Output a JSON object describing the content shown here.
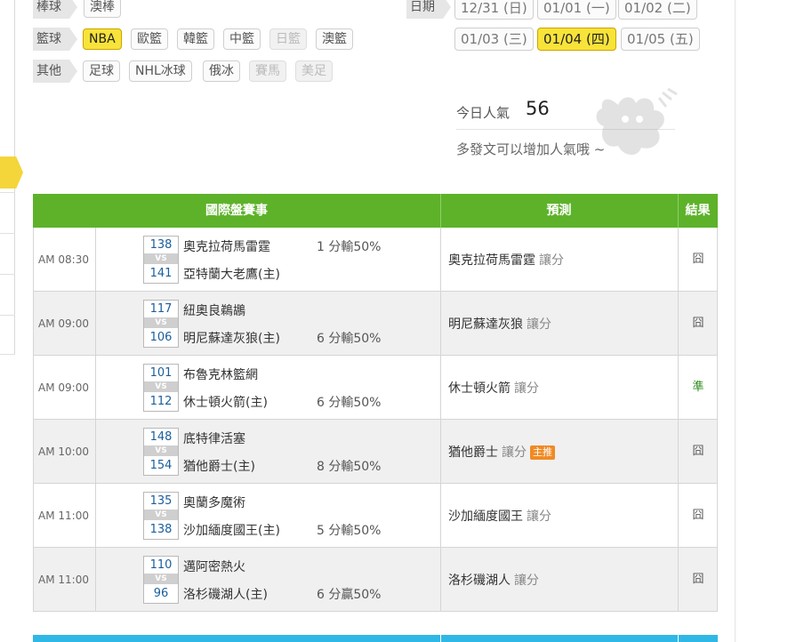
{
  "categories": [
    {
      "label": "棒球",
      "tags": [
        {
          "text": "澳棒",
          "state": "normal"
        }
      ]
    },
    {
      "label": "籃球",
      "tags": [
        {
          "text": "NBA",
          "state": "active"
        },
        {
          "text": "歐籃",
          "state": "normal"
        },
        {
          "text": "韓籃",
          "state": "normal"
        },
        {
          "text": "中籃",
          "state": "normal"
        },
        {
          "text": "日籃",
          "state": "disabled"
        },
        {
          "text": "澳籃",
          "state": "normal"
        }
      ]
    },
    {
      "label": "其他",
      "tags": [
        {
          "text": "足球",
          "state": "normal"
        },
        {
          "text": "NHL冰球",
          "state": "normal"
        },
        {
          "text": "俄冰",
          "state": "normal"
        },
        {
          "text": "賽馬",
          "state": "disabled"
        },
        {
          "text": "美足",
          "state": "disabled"
        }
      ]
    }
  ],
  "date_filter": {
    "label": "日期",
    "dates": [
      {
        "text": "12/31 (日)",
        "state": "normal"
      },
      {
        "text": "01/01 (一)",
        "state": "normal"
      },
      {
        "text": "01/02 (二)",
        "state": "normal"
      },
      {
        "text": "01/03 (三)",
        "state": "normal"
      },
      {
        "text": "01/04 (四)",
        "state": "active"
      },
      {
        "text": "01/05 (五)",
        "state": "normal"
      }
    ]
  },
  "popularity": {
    "label": "今日人氣",
    "value": "56",
    "note": "多發文可以增加人氣哦 ~"
  },
  "table": {
    "headers": {
      "game": "國際盤賽事",
      "prediction": "預測",
      "result": "結果"
    },
    "vs_label": "VS",
    "rows": [
      {
        "time": "AM 08:30",
        "score1": "138",
        "team1": "奧克拉荷馬雷霆",
        "score2": "141",
        "team2": "亞特蘭大老鷹(主)",
        "line": "1 分輸50%",
        "line_row": "top",
        "pred_team": "奧克拉荷馬雷霆",
        "pred_type": "讓分",
        "badge": "",
        "result": "囧"
      },
      {
        "time": "AM 09:00",
        "score1": "117",
        "team1": "紐奧良鵜鶘",
        "score2": "106",
        "team2": "明尼蘇達灰狼(主)",
        "line": "6 分輸50%",
        "line_row": "bottom",
        "pred_team": "明尼蘇達灰狼",
        "pred_type": "讓分",
        "badge": "",
        "result": "囧"
      },
      {
        "time": "AM 09:00",
        "score1": "101",
        "team1": "布魯克林籃網",
        "score2": "112",
        "team2": "休士頓火箭(主)",
        "line": "6 分輸50%",
        "line_row": "bottom",
        "pred_team": "休士頓火箭",
        "pred_type": "讓分",
        "badge": "",
        "result": "準"
      },
      {
        "time": "AM 10:00",
        "score1": "148",
        "team1": "底特律活塞",
        "score2": "154",
        "team2": "猶他爵士(主)",
        "line": "8 分輸50%",
        "line_row": "bottom",
        "pred_team": "猶他爵士",
        "pred_type": "讓分",
        "badge": "主推",
        "result": "囧"
      },
      {
        "time": "AM 11:00",
        "score1": "135",
        "team1": "奧蘭多魔術",
        "score2": "138",
        "team2": "沙加緬度國王(主)",
        "line": "5 分輸50%",
        "line_row": "bottom",
        "pred_team": "沙加緬度國王",
        "pred_type": "讓分",
        "badge": "",
        "result": "囧"
      },
      {
        "time": "AM 11:00",
        "score1": "110",
        "team1": "邁阿密熱火",
        "score2": "96",
        "team2": "洛杉磯湖人(主)",
        "line": "6 分贏50%",
        "line_row": "bottom",
        "pred_team": "洛杉磯湖人",
        "pred_type": "讓分",
        "badge": "",
        "result": "囧"
      }
    ]
  },
  "colors": {
    "header_green": "#5db22a",
    "active_yellow": "#f8e33a",
    "score_blue": "#1a5f9c",
    "badge_orange": "#f08a24",
    "win_green": "#2e8b1e",
    "footer_blue": "#2fb8e6"
  }
}
